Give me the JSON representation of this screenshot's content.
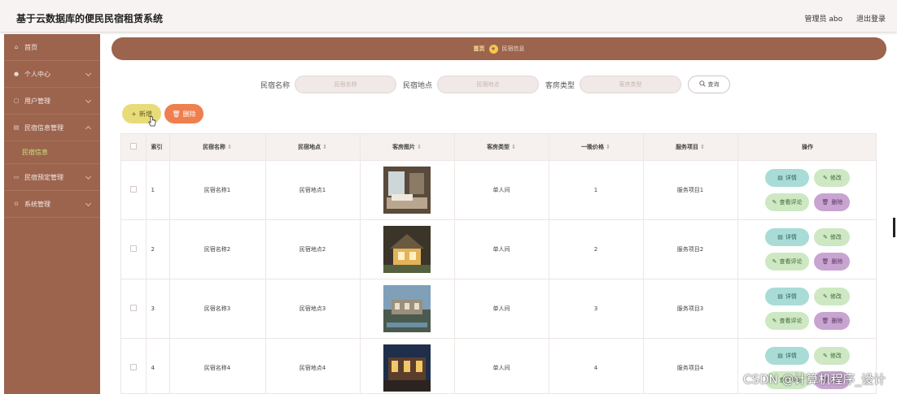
{
  "header": {
    "title": "基于云数据库的便民民宿租赁系统",
    "user_label": "管理员 abo",
    "logout_label": "退出登录"
  },
  "sidebar": {
    "items": [
      {
        "label": "首页",
        "icon": "home-icon"
      },
      {
        "label": "个人中心",
        "icon": "user-icon"
      },
      {
        "label": "用户管理",
        "icon": "users-icon"
      },
      {
        "label": "民宿信息管理",
        "icon": "house-icon"
      },
      {
        "label": "民宿信息",
        "icon": ""
      },
      {
        "label": "民宿预定管理",
        "icon": "calendar-icon"
      },
      {
        "label": "系统管理",
        "icon": "settings-icon"
      }
    ]
  },
  "breadcrumb": {
    "home": "首页",
    "current": "民宿信息"
  },
  "filters": {
    "name_label": "民宿名称",
    "name_placeholder": "民宿名称",
    "location_label": "民宿地点",
    "location_placeholder": "民宿地点",
    "room_type_label": "客房类型",
    "room_type_placeholder": "客房类型",
    "query_label": "查询"
  },
  "toolbar": {
    "add_label": "新增",
    "delete_label": "删除"
  },
  "table": {
    "columns": [
      "索引",
      "民宿名称",
      "民宿地点",
      "客房图片",
      "客房类型",
      "一晚价格",
      "服务项目",
      "操作"
    ],
    "rows": [
      {
        "index": "1",
        "name": "民宿名称1",
        "location": "民宿地点1",
        "room_type": "单人间",
        "price": "1",
        "service": "服务项目1"
      },
      {
        "index": "2",
        "name": "民宿名称2",
        "location": "民宿地点2",
        "room_type": "单人间",
        "price": "2",
        "service": "服务项目2"
      },
      {
        "index": "3",
        "name": "民宿名称3",
        "location": "民宿地点3",
        "room_type": "单人间",
        "price": "3",
        "service": "服务项目3"
      },
      {
        "index": "4",
        "name": "民宿名称4",
        "location": "民宿地点4",
        "room_type": "单人间",
        "price": "4",
        "service": "服务项目4"
      }
    ],
    "ops": {
      "detail": "详情",
      "edit": "修改",
      "review": "查看评论",
      "delete": "删除"
    }
  },
  "watermark": "CSDN @计算机程序_设计",
  "colors": {
    "primary": "#9c634d",
    "add": "#e8dc7a",
    "delete": "#ef7f4e",
    "detail": "#a9dcd6",
    "edit": "#cde8c2",
    "row_delete": "#c8a4d1",
    "active_sub": "#cfe07e"
  }
}
